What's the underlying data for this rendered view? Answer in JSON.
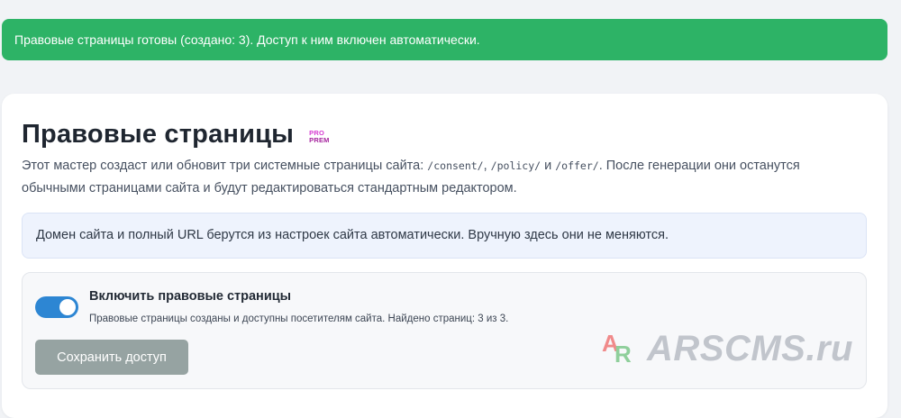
{
  "alert": {
    "text": "Правовые страницы готовы (создано: 3). Доступ к ним включен автоматически."
  },
  "header": {
    "title": "Правовые страницы",
    "badge_top": "PRO",
    "badge_bottom": "PREM"
  },
  "intro": {
    "text_1": "Этот мастер создаст или обновит три системные страницы сайта: ",
    "path_consent": "/consent/",
    "sep_1": ", ",
    "path_policy": "/policy/",
    "sep_2": " и ",
    "path_offer": "/offer/",
    "text_2": ". После генерации они останутся обычными страницами сайта и будут редактироваться стандартным редактором."
  },
  "info": {
    "text": "Домен сайта и полный URL берутся из настроек сайта автоматически. Вручную здесь они не меняются."
  },
  "access": {
    "toggle_label": "Включить правовые страницы",
    "toggle_on": true,
    "status": "Правовые страницы созданы и доступны посетителям сайта. Найдено страниц: 3 из 3.",
    "save_label": "Сохранить доступ"
  },
  "watermark": {
    "logo_a": "A",
    "logo_r": "R",
    "text": "ARSCMS.ru"
  },
  "colors": {
    "success": "#2db366",
    "toggle_accent": "#2d86d3",
    "info_bg": "#eef3fd",
    "button_disabled": "#96a3a2"
  }
}
